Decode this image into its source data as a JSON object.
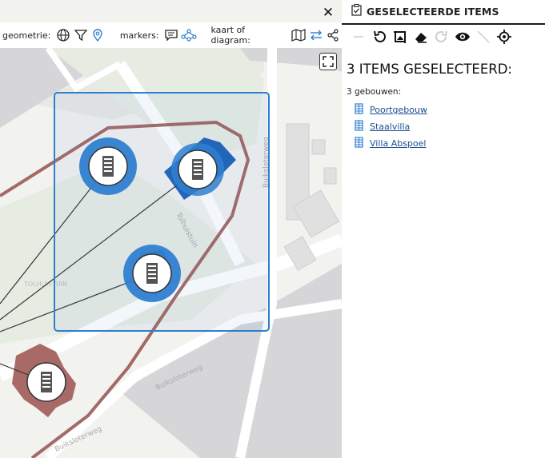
{
  "map": {
    "toolbar": {
      "geometry_label": "geometrie:",
      "markers_label": "markers:",
      "view_label": "kaart of diagram:"
    },
    "street_labels": [
      "Tolhuistuin",
      "Buiksloterweg",
      "Buiksloterweg",
      "TOLHUISTUIN"
    ],
    "markers": [
      {
        "name": "Poortgebouw",
        "selected": true
      },
      {
        "name": "Staalvilla",
        "selected": true
      },
      {
        "name": "Villa Abspoel",
        "selected": true
      },
      {
        "name": "gebouw",
        "selected": false
      }
    ],
    "colors": {
      "selection": "#2f7fd0",
      "building": "#a86a66",
      "route": "#9b5a58"
    }
  },
  "panel": {
    "title": "GESELECTEERDE ITEMS",
    "count_title": "3 ITEMS GESELECTEERD:",
    "group_label": "3 gebouwen:",
    "items": [
      {
        "label": "Poortgebouw",
        "icon": "building-icon"
      },
      {
        "label": "Staalvilla",
        "icon": "building-icon"
      },
      {
        "label": "Villa Abspoel",
        "icon": "building-icon"
      }
    ]
  }
}
